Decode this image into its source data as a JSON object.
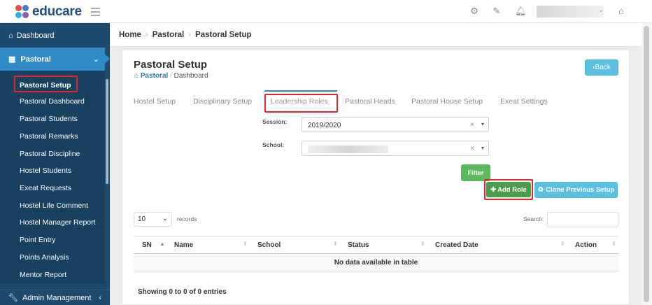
{
  "brand": {
    "name": "educare"
  },
  "topbar": {
    "icons": [
      "gear-icon",
      "edit-icon",
      "bell-icon",
      "home-icon"
    ]
  },
  "sidebar": {
    "dashboard": "Dashboard",
    "pastoral": "Pastoral",
    "items": [
      "Pastoral Setup",
      "Pastoral Dashboard",
      "Pastoral Students",
      "Pastoral Remarks",
      "Pastoral Discipline",
      "Hostel Students",
      "Exeat Requests",
      "Hostel Life Comment",
      "Hostel Manager Report",
      "Point Entry",
      "Points Analysis",
      "Mentor Report"
    ],
    "admin": "Admin Management"
  },
  "breadcrumb": [
    "Home",
    "Pastoral",
    "Pastoral Setup"
  ],
  "page": {
    "title": "Pastoral Setup",
    "sub_parent": "Pastoral",
    "sub_current": "Dashboard",
    "back": "Back"
  },
  "tabs": [
    "Hostel Setup",
    "Disciplinary Setup",
    "Leadership Roles",
    "Pastoral Heads",
    "Pastoral House Setup",
    "Exeat Settings"
  ],
  "form": {
    "session_label": "Session:",
    "session_value": "2019/2020",
    "school_label": "School:",
    "filter": "Filter",
    "add_role": "Add Role",
    "clone": "Clone Previous Setup"
  },
  "table": {
    "length": "10",
    "records": "records",
    "search": "Search:",
    "headers": [
      "SN",
      "Name",
      "School",
      "Status",
      "Created Date",
      "Action"
    ],
    "empty": "No data available in table",
    "info": "Showing 0 to 0 of 0 entries"
  },
  "colors": {
    "sidebar": "#1e4a6d",
    "active": "#2e8bc6",
    "highlight": "#e0282c"
  }
}
